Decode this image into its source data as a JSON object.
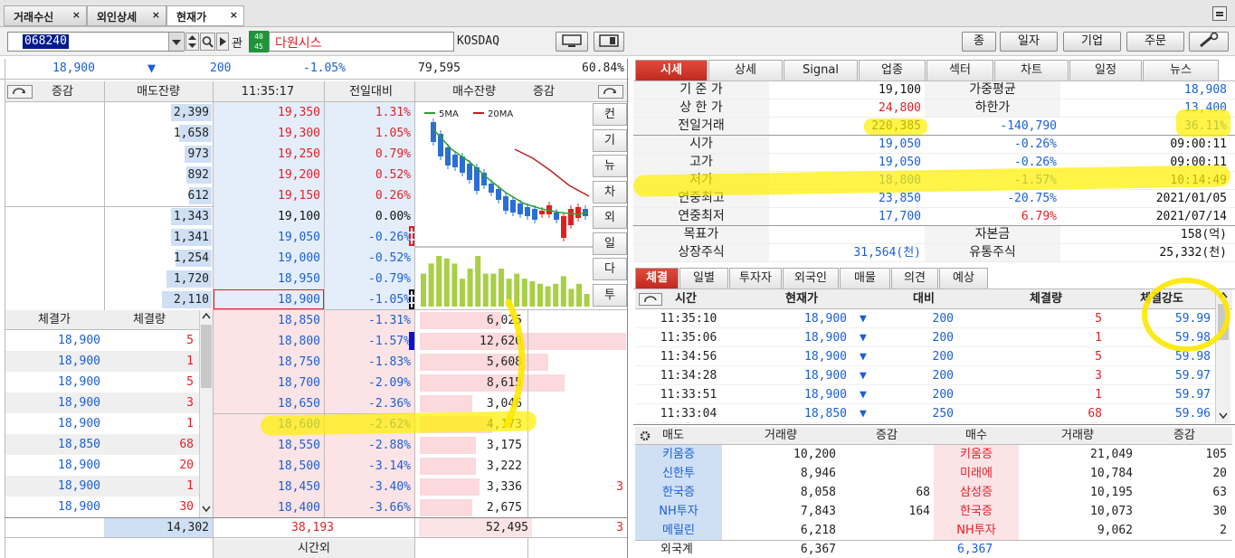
{
  "tabs": [
    {
      "label": "거래수신"
    },
    {
      "label": "외인상세"
    },
    {
      "label": "현재가"
    }
  ],
  "tab_close": "×",
  "stock": {
    "code": "068240",
    "gwan": "관",
    "badge_top": "40",
    "badge_bottom": "45",
    "name": "다원시스",
    "market": "KOSDAQ"
  },
  "toolbar_buttons": {
    "jong": "종",
    "ilja": "일자",
    "giup": "기업",
    "jumun": "주문"
  },
  "price_bar": {
    "price": "18,900",
    "arrow": "▼",
    "change": "200",
    "rate": "-1.05%",
    "volume": "79,595",
    "ratio": "60.84%"
  },
  "order_headers": {
    "jeunggam_l": "증감",
    "sell_rem": "매도잔량",
    "time": "11:35:17",
    "prev": "전일대비",
    "buy_rem": "매수잔량",
    "jeunggam_r": "증감"
  },
  "asks": [
    {
      "rem": "2,399",
      "price": "19,350",
      "rate": "1.31%"
    },
    {
      "rem": "1,658",
      "price": "19,300",
      "rate": "1.05%"
    },
    {
      "rem": "973",
      "price": "19,250",
      "rate": "0.79%"
    },
    {
      "rem": "892",
      "price": "19,200",
      "rate": "0.52%"
    },
    {
      "rem": "612",
      "price": "19,150",
      "rate": "0.26%"
    },
    {
      "rem": "1,343",
      "price": "19,100",
      "rate": "0.00%"
    },
    {
      "rem": "1,341",
      "price": "19,050",
      "rate": "-0.26%"
    },
    {
      "rem": "1,254",
      "price": "19,000",
      "rate": "-0.52%"
    },
    {
      "rem": "1,720",
      "price": "18,950",
      "rate": "-0.79%"
    },
    {
      "rem": "2,110",
      "price": "18,900",
      "rate": "-1.05%"
    }
  ],
  "bids": [
    {
      "price": "18,850",
      "rate": "-1.31%",
      "rem": "6,025",
      "chg": ""
    },
    {
      "price": "18,800",
      "rate": "-1.57%",
      "rem": "12,620",
      "chg": ""
    },
    {
      "price": "18,750",
      "rate": "-1.83%",
      "rem": "5,608",
      "chg": ""
    },
    {
      "price": "18,700",
      "rate": "-2.09%",
      "rem": "8,615",
      "chg": ""
    },
    {
      "price": "18,650",
      "rate": "-2.36%",
      "rem": "3,046",
      "chg": ""
    },
    {
      "price": "18,600",
      "rate": "-2.62%",
      "rem": "4,173",
      "chg": ""
    },
    {
      "price": "18,550",
      "rate": "-2.88%",
      "rem": "3,175",
      "chg": ""
    },
    {
      "price": "18,500",
      "rate": "-3.14%",
      "rem": "3,222",
      "chg": ""
    },
    {
      "price": "18,450",
      "rate": "-3.40%",
      "rem": "3,336",
      "chg": "3"
    },
    {
      "price": "18,400",
      "rate": "-3.66%",
      "rem": "2,675",
      "chg": ""
    }
  ],
  "exec_headers": {
    "price": "체결가",
    "qty": "체결량"
  },
  "exec_left": [
    {
      "price": "18,900",
      "qty": "5"
    },
    {
      "price": "18,900",
      "qty": "1"
    },
    {
      "price": "18,900",
      "qty": "5"
    },
    {
      "price": "18,900",
      "qty": "3"
    },
    {
      "price": "18,900",
      "qty": "1"
    },
    {
      "price": "18,850",
      "qty": "68"
    },
    {
      "price": "18,900",
      "qty": "20"
    },
    {
      "price": "18,900",
      "qty": "1"
    },
    {
      "price": "18,900",
      "qty": "30"
    }
  ],
  "totals": {
    "sell": "14,302",
    "mid": "38,193",
    "buy": "52,495",
    "chg": "3"
  },
  "after_hours": "시간외",
  "mini_chart": {
    "legend5": "5MA",
    "legend20": "20MA"
  },
  "side_buttons": [
    "컨",
    "기",
    "뉴",
    "차",
    "외",
    "일",
    "다",
    "투"
  ],
  "right_tabs": [
    "시세",
    "상세",
    "Signal",
    "업종",
    "섹터",
    "차트",
    "일정",
    "뉴스"
  ],
  "info": [
    {
      "l": "기 준 가",
      "v": "19,100",
      "l2": "가중평균",
      "v2": "18,908"
    },
    {
      "l": "상 한 가",
      "v": "24,800",
      "l2": "하한가",
      "v2": "13,400"
    },
    {
      "l": "전일거래",
      "v": "220,385",
      "d": "-140,790",
      "v2": "36.11%"
    },
    {
      "l": "시가",
      "v": "19,050",
      "d": "-0.26%",
      "v2": "09:00:11"
    },
    {
      "l": "고가",
      "v": "19,050",
      "d": "-0.26%",
      "v2": "09:00:11"
    },
    {
      "l": "저가",
      "v": "18,800",
      "d": "-1.57%",
      "v2": "10:14:49"
    },
    {
      "l": "연중최고",
      "v": "23,850",
      "d": "-20.75%",
      "v2": "2021/01/05"
    },
    {
      "l": "연중최저",
      "v": "17,700",
      "d": "6.79%",
      "v2": "2021/07/14"
    },
    {
      "l": "목표가",
      "v": "",
      "l2": "자본금",
      "v2": "158(억)"
    },
    {
      "l": "상장주식",
      "v": "31,564(천)",
      "l2": "유통주식",
      "v2": "25,332(천)"
    }
  ],
  "sub_tabs": [
    "체결",
    "일별",
    "투자자",
    "외국인",
    "매물",
    "의견",
    "예상"
  ],
  "trade_headers": {
    "time": "시간",
    "price": "현재가",
    "diff": "대비",
    "qty": "체결량",
    "strength": "체결강도"
  },
  "trades": [
    {
      "time": "11:35:10",
      "price": "18,900",
      "diff": "200",
      "qty": "5",
      "strength": "59.99"
    },
    {
      "time": "11:35:06",
      "price": "18,900",
      "diff": "200",
      "qty": "1",
      "strength": "59.98"
    },
    {
      "time": "11:34:56",
      "price": "18,900",
      "diff": "200",
      "qty": "5",
      "strength": "59.98"
    },
    {
      "time": "11:34:28",
      "price": "18,900",
      "diff": "200",
      "qty": "3",
      "strength": "59.97"
    },
    {
      "time": "11:33:51",
      "price": "18,900",
      "diff": "200",
      "qty": "1",
      "strength": "59.97"
    },
    {
      "time": "11:33:04",
      "price": "18,850",
      "diff": "250",
      "qty": "68",
      "strength": "59.96"
    }
  ],
  "broker_headers": {
    "sell": "매도",
    "vol1": "거래량",
    "chg1": "증감",
    "buy": "매수",
    "vol2": "거래량",
    "chg2": "증감"
  },
  "brokers": [
    {
      "s": "키움증",
      "sv": "10,200",
      "sc": "",
      "b": "키움증",
      "bv": "21,049",
      "bc": "105"
    },
    {
      "s": "신한투",
      "sv": "8,946",
      "sc": "",
      "b": "미래에",
      "bv": "10,784",
      "bc": "20"
    },
    {
      "s": "한국증",
      "sv": "8,058",
      "sc": "68",
      "b": "삼성증",
      "bv": "10,195",
      "bc": "63"
    },
    {
      "s": "NH투자",
      "sv": "7,843",
      "sc": "164",
      "b": "한국증",
      "bv": "10,073",
      "bc": "30"
    },
    {
      "s": "메릴린",
      "sv": "6,218",
      "sc": "",
      "b": "NH투자",
      "bv": "9,062",
      "bc": "2"
    }
  ],
  "foreign_total": {
    "label": "외국계",
    "sell": "6,367",
    "buy": "6,367"
  }
}
